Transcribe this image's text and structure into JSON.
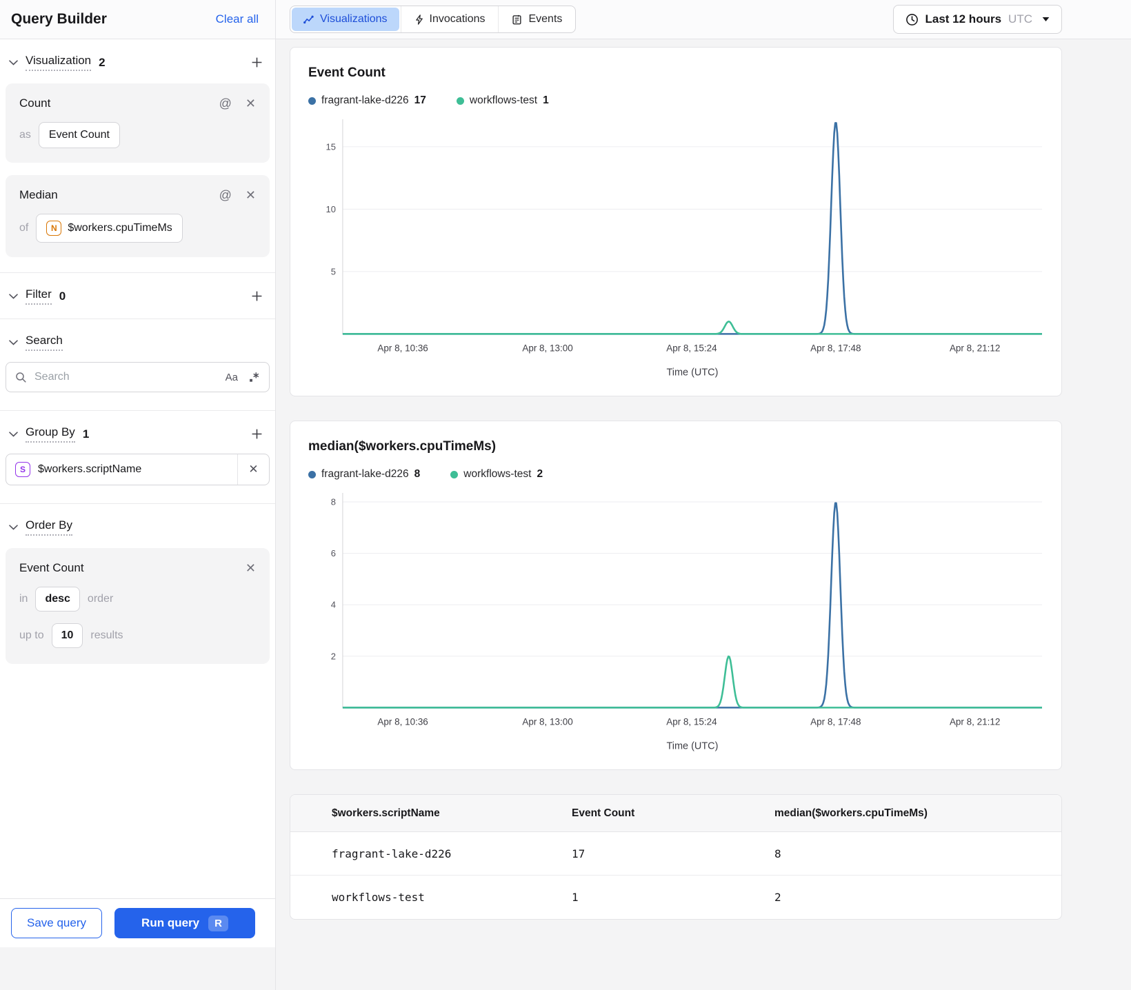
{
  "icons": {
    "at": "@",
    "close": "✕",
    "match_case": "Aa"
  },
  "sidebar": {
    "title": "Query Builder",
    "clear_all": "Clear all",
    "visualization": {
      "label": "Visualization",
      "count": "2"
    },
    "viz_cards": [
      {
        "title": "Count",
        "prefix": "as",
        "value": "Event Count"
      },
      {
        "title": "Median",
        "prefix": "of",
        "value": "$workers.cpuTimeMs",
        "type_letter": "N"
      }
    ],
    "filter": {
      "label": "Filter",
      "count": "0"
    },
    "search": {
      "label": "Search",
      "placeholder": "Search"
    },
    "group_by": {
      "label": "Group By",
      "count": "1",
      "value": "$workers.scriptName",
      "type_letter": "S"
    },
    "order_by": {
      "label": "Order By",
      "field": "Event Count",
      "in_label": "in",
      "direction": "desc",
      "order_label": "order",
      "up_to_label": "up to",
      "limit": "10",
      "results_label": "results"
    },
    "save_button": "Save query",
    "run_button": "Run query",
    "run_shortcut": "R"
  },
  "tabs": [
    {
      "label": "Visualizations",
      "active": true
    },
    {
      "label": "Invocations",
      "active": false
    },
    {
      "label": "Events",
      "active": false
    }
  ],
  "time_selector": {
    "label": "Last 12 hours",
    "timezone": "UTC"
  },
  "chart_data": [
    {
      "type": "line",
      "title": "Event Count",
      "xlabel": "Time (UTC)",
      "x_ticks": [
        "Apr 8, 10:36",
        "Apr 8, 13:00",
        "Apr 8, 15:24",
        "Apr 8, 17:48",
        "Apr 8, 21:12"
      ],
      "x_tick_fracs": [
        0.086,
        0.293,
        0.499,
        0.705,
        0.904
      ],
      "ylim": [
        0,
        17.2
      ],
      "y_ticks": [
        5,
        10,
        15
      ],
      "grid": true,
      "legend_position": "top",
      "series": [
        {
          "name": "fragrant-lake-d226",
          "color": "#3B71A5",
          "total": 17,
          "baseline": 0,
          "peaks": [
            {
              "x": 0.705,
              "height": 17,
              "sigma": 0.0092
            }
          ]
        },
        {
          "name": "workflows-test",
          "color": "#3EBE96",
          "total": 1,
          "baseline": 0,
          "peaks": [
            {
              "x": 0.552,
              "height": 1,
              "sigma": 0.008
            }
          ]
        }
      ]
    },
    {
      "type": "line",
      "title": "median($workers.cpuTimeMs)",
      "xlabel": "Time (UTC)",
      "x_ticks": [
        "Apr 8, 10:36",
        "Apr 8, 13:00",
        "Apr 8, 15:24",
        "Apr 8, 17:48",
        "Apr 8, 21:12"
      ],
      "x_tick_fracs": [
        0.086,
        0.293,
        0.499,
        0.705,
        0.904
      ],
      "ylim": [
        0,
        8.35
      ],
      "y_ticks": [
        2,
        4,
        6,
        8
      ],
      "grid": true,
      "legend_position": "top",
      "series": [
        {
          "name": "fragrant-lake-d226",
          "color": "#3B71A5",
          "total": 8,
          "baseline": 0,
          "peaks": [
            {
              "x": 0.705,
              "height": 8,
              "sigma": 0.0092
            }
          ]
        },
        {
          "name": "workflows-test",
          "color": "#3EBE96",
          "total": 2,
          "baseline": 0,
          "peaks": [
            {
              "x": 0.552,
              "height": 2,
              "sigma": 0.008
            }
          ]
        }
      ]
    }
  ],
  "table": {
    "columns": [
      "$workers.scriptName",
      "Event Count",
      "median($workers.cpuTimeMs)"
    ],
    "rows": [
      {
        "color": "#3B71A5",
        "name": "fragrant-lake-d226",
        "event_count": "17",
        "median": "8"
      },
      {
        "color": "#3EBE96",
        "name": "workflows-test",
        "event_count": "1",
        "median": "2"
      }
    ]
  }
}
